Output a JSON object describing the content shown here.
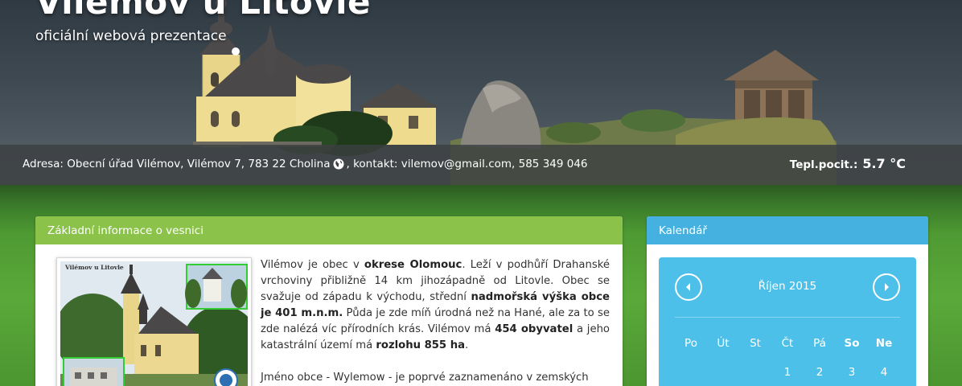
{
  "header": {
    "title": "Vilémov u Litovle",
    "subtitle": "oficiální webová prezentace"
  },
  "infobar": {
    "address": "Adresa: Obecní úřad Vilémov, Vilémov 7, 783 22 Cholina",
    "contact": ", kontakt: vilemov@gmail.com, 585 349 046",
    "temp_label": "Tepl.pocit.:",
    "temp_value": "5.7 °C"
  },
  "info_panel": {
    "title": "Základní informace o vesnici",
    "postcard_caption": "Vilémov u Litovle",
    "p1": [
      "Vilémov je obec v ",
      "okrese Olomouc",
      ". Leží v podhůří Drahanské vrchoviny přibližně 14 km jihozápadně od Litovle. Obec se svažuje od západu k východu, střední ",
      "nadmořská výška obce je 401 m.n.m.",
      " Půda je zde míň úrodná než na Hané, ale za to se zde nalézá víc přírodních krás. Vilémov má ",
      "454 obyvatel",
      " a jeho katastrální území má ",
      "rozlohu 855 ha",
      "."
    ],
    "p2": "Jméno obce - Wylemow - je poprvé zaznamenáno v zemských"
  },
  "calendar": {
    "title": "Kalendář",
    "month": "Říjen 2015",
    "weekdays": [
      "Po",
      "Út",
      "St",
      "Čt",
      "Pá",
      "So",
      "Ne"
    ],
    "first_week": [
      "",
      "",
      "",
      "1",
      "2",
      "3",
      "4"
    ]
  },
  "icons": {
    "globe": "globe-icon",
    "prev": "chevron-left-icon",
    "next": "chevron-right-icon"
  },
  "colors": {
    "info_header": "#8bc34a",
    "calendar_header": "#45b1e0",
    "calendar_body": "#4cc0e8"
  }
}
